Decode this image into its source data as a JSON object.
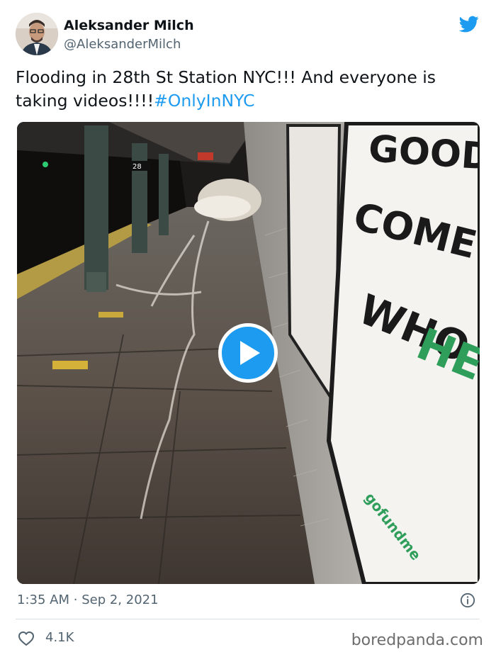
{
  "author": {
    "name": "Aleksander Milch",
    "handle": "@AleksanderMilch"
  },
  "tweet": {
    "text": "Flooding in 28th St Station NYC!!! And everyone is taking videos!!!!",
    "hashtag": "#OnlyInNYC"
  },
  "media": {
    "type": "video",
    "poster_description_icon": "play-icon",
    "station_sign_text": "28",
    "poster_text": {
      "line1": "GOOD THIN",
      "line2": "COME TO THO",
      "line3": "WHO",
      "line4": "HELP",
      "brand": "gofundme"
    }
  },
  "meta": {
    "time": "1:35 AM",
    "separator": "·",
    "date": "Sep 2, 2021"
  },
  "actions": {
    "likes": "4.1K"
  },
  "watermark": "boredpanda.com",
  "colors": {
    "accent": "#1d9bf0",
    "secondary_text": "#536471",
    "poster_green": "#2f9e5a"
  }
}
